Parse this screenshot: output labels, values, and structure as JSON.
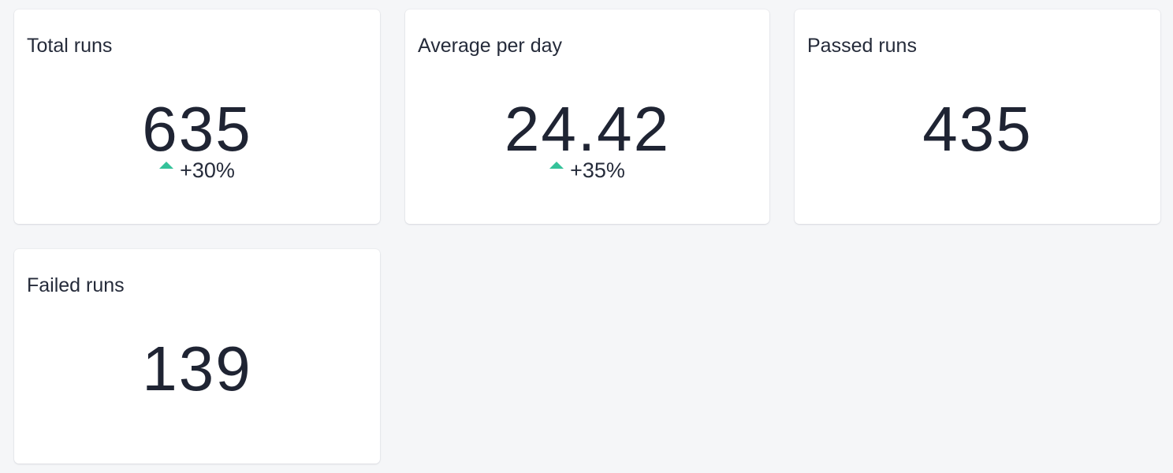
{
  "accent_color": "#35c29a",
  "cards": [
    {
      "title": "Total runs",
      "value": "635",
      "delta": "+30%",
      "trend": "up"
    },
    {
      "title": "Average per day",
      "value": "24.42",
      "delta": "+35%",
      "trend": "up"
    },
    {
      "title": "Passed runs",
      "value": "435"
    },
    {
      "title": "Failed runs",
      "value": "139"
    }
  ]
}
